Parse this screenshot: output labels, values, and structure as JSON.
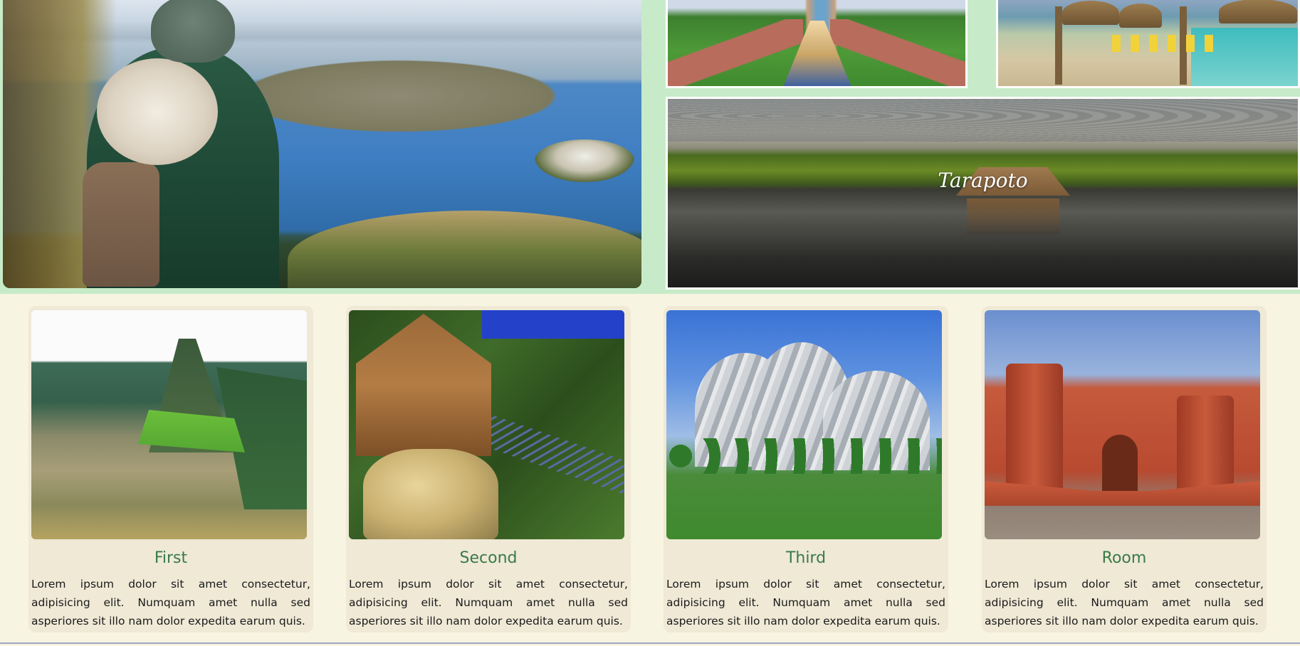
{
  "hero": {
    "wide_tile_label": "Tarapoto"
  },
  "cards": [
    {
      "title": "First",
      "text": "Lorem ipsum dolor sit amet consectetur, adipisicing elit. Numquam amet nulla sed asperiores sit illo nam dolor expedita earum quis."
    },
    {
      "title": "Second",
      "text": "Lorem ipsum dolor sit amet consectetur, adipisicing elit. Numquam amet nulla sed asperiores sit illo nam dolor expedita earum quis."
    },
    {
      "title": "Third",
      "text": "Lorem ipsum dolor sit amet consectetur, adipisicing elit. Numquam amet nulla sed asperiores sit illo nam dolor expedita earum quis."
    },
    {
      "title": "Room",
      "text": "Lorem ipsum dolor sit amet consectetur, adipisicing elit. Numquam amet nulla sed asperiores sit illo nam dolor expedita earum quis."
    }
  ],
  "colors": {
    "page_background": "#f7f4e1",
    "gallery_background": "#c7ebc8",
    "card_background": "#efe9d6",
    "card_title": "#3a7a47"
  }
}
